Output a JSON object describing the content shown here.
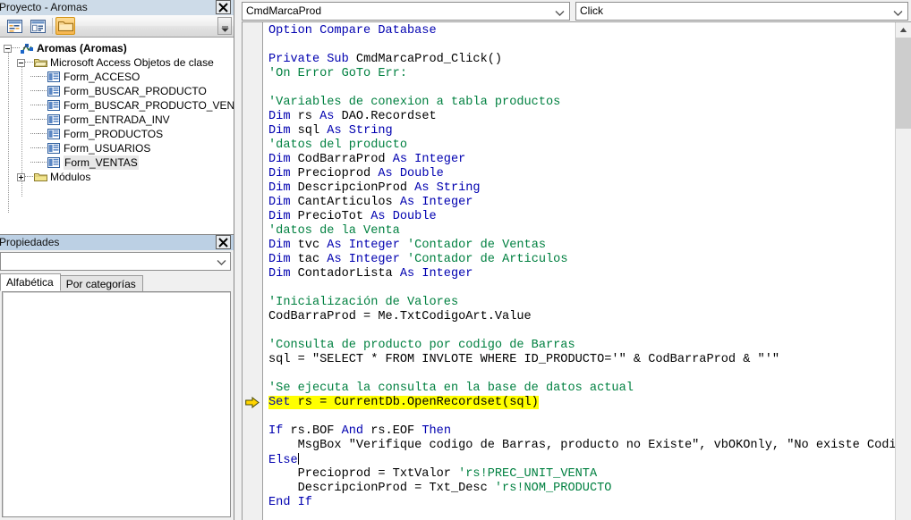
{
  "project_pane": {
    "title": "Proyecto - Aromas",
    "close_icon": "close-icon",
    "toolbar": {
      "view_code_label": "Ver código",
      "view_object_label": "Ver objeto",
      "toggle_folders_label": "Alternar carpetas",
      "overflow_label": "Más botones"
    },
    "tree": [
      {
        "label": "Aromas (Aromas)",
        "icon": "project-icon",
        "depth": 0,
        "expander": "minus",
        "bold": true
      },
      {
        "label": "Microsoft Access Objetos de clase",
        "icon": "folder-open-icon",
        "depth": 1,
        "expander": "minus",
        "bold": false
      },
      {
        "label": "Form_ACCESO",
        "icon": "form-module-icon",
        "depth": 2,
        "expander": "none",
        "bold": false
      },
      {
        "label": "Form_BUSCAR_PRODUCTO",
        "icon": "form-module-icon",
        "depth": 2,
        "expander": "none",
        "bold": false
      },
      {
        "label": "Form_BUSCAR_PRODUCTO_VENTA",
        "icon": "form-module-icon",
        "depth": 2,
        "expander": "none",
        "bold": false
      },
      {
        "label": "Form_ENTRADA_INV",
        "icon": "form-module-icon",
        "depth": 2,
        "expander": "none",
        "bold": false
      },
      {
        "label": "Form_PRODUCTOS",
        "icon": "form-module-icon",
        "depth": 2,
        "expander": "none",
        "bold": false
      },
      {
        "label": "Form_USUARIOS",
        "icon": "form-module-icon",
        "depth": 2,
        "expander": "none",
        "bold": false
      },
      {
        "label": "Form_VENTAS",
        "icon": "form-module-icon",
        "depth": 2,
        "expander": "none",
        "bold": false,
        "selected": true
      },
      {
        "label": "Módulos",
        "icon": "folder-closed-icon",
        "depth": 1,
        "expander": "plus",
        "bold": false
      }
    ]
  },
  "properties_pane": {
    "title": "Propiedades",
    "close_icon": "close-icon",
    "selector_value": "",
    "tabs": [
      {
        "label": "Alfabética",
        "active": true
      },
      {
        "label": "Por categorías",
        "active": false
      }
    ],
    "list_rows": []
  },
  "code_window": {
    "object_combo": {
      "value": "CmdMarcaProd",
      "caret_icon": "chevron-down-icon"
    },
    "procedure_combo": {
      "value": "Click",
      "caret_icon": "chevron-down-icon"
    },
    "margin_marker_icon": "yellow-arrow-icon",
    "margin_marker_line": 28,
    "scrollbar": {
      "up_icon": "chevron-up-icon",
      "thumb_position": "top"
    },
    "lines": [
      {
        "n": 1,
        "segs": [
          {
            "t": "Option Compare Database",
            "c": "kw"
          }
        ]
      },
      {
        "n": 2,
        "segs": []
      },
      {
        "n": 3,
        "segs": [
          {
            "t": "Private Sub ",
            "c": "kw"
          },
          {
            "t": "CmdMarcaProd_Click()",
            "c": "tx"
          }
        ]
      },
      {
        "n": 4,
        "segs": [
          {
            "t": "'On Error GoTo Err:",
            "c": "cm"
          }
        ]
      },
      {
        "n": 5,
        "segs": []
      },
      {
        "n": 6,
        "segs": [
          {
            "t": "'Variables de conexion a tabla productos",
            "c": "cm"
          }
        ]
      },
      {
        "n": 7,
        "segs": [
          {
            "t": "Dim ",
            "c": "kw"
          },
          {
            "t": "rs ",
            "c": "tx"
          },
          {
            "t": "As ",
            "c": "kw"
          },
          {
            "t": "DAO.Recordset",
            "c": "tx"
          }
        ]
      },
      {
        "n": 8,
        "segs": [
          {
            "t": "Dim ",
            "c": "kw"
          },
          {
            "t": "sql ",
            "c": "tx"
          },
          {
            "t": "As String",
            "c": "kw"
          }
        ]
      },
      {
        "n": 9,
        "segs": [
          {
            "t": "'datos del producto",
            "c": "cm"
          }
        ]
      },
      {
        "n": 10,
        "segs": [
          {
            "t": "Dim ",
            "c": "kw"
          },
          {
            "t": "CodBarraProd ",
            "c": "tx"
          },
          {
            "t": "As Integer",
            "c": "kw"
          }
        ]
      },
      {
        "n": 11,
        "segs": [
          {
            "t": "Dim ",
            "c": "kw"
          },
          {
            "t": "Precioprod ",
            "c": "tx"
          },
          {
            "t": "As Double",
            "c": "kw"
          }
        ]
      },
      {
        "n": 12,
        "segs": [
          {
            "t": "Dim ",
            "c": "kw"
          },
          {
            "t": "DescripcionProd ",
            "c": "tx"
          },
          {
            "t": "As String",
            "c": "kw"
          }
        ]
      },
      {
        "n": 13,
        "segs": [
          {
            "t": "Dim ",
            "c": "kw"
          },
          {
            "t": "CantArticulos ",
            "c": "tx"
          },
          {
            "t": "As Integer",
            "c": "kw"
          }
        ]
      },
      {
        "n": 14,
        "segs": [
          {
            "t": "Dim ",
            "c": "kw"
          },
          {
            "t": "PrecioTot ",
            "c": "tx"
          },
          {
            "t": "As Double",
            "c": "kw"
          }
        ]
      },
      {
        "n": 15,
        "segs": [
          {
            "t": "'datos de la Venta",
            "c": "cm"
          }
        ]
      },
      {
        "n": 16,
        "segs": [
          {
            "t": "Dim ",
            "c": "kw"
          },
          {
            "t": "tvc ",
            "c": "tx"
          },
          {
            "t": "As Integer ",
            "c": "kw"
          },
          {
            "t": "'Contador de Ventas",
            "c": "cm"
          }
        ]
      },
      {
        "n": 17,
        "segs": [
          {
            "t": "Dim ",
            "c": "kw"
          },
          {
            "t": "tac ",
            "c": "tx"
          },
          {
            "t": "As Integer ",
            "c": "kw"
          },
          {
            "t": "'Contador de Articulos",
            "c": "cm"
          }
        ]
      },
      {
        "n": 18,
        "segs": [
          {
            "t": "Dim ",
            "c": "kw"
          },
          {
            "t": "ContadorLista ",
            "c": "tx"
          },
          {
            "t": "As Integer",
            "c": "kw"
          }
        ]
      },
      {
        "n": 19,
        "segs": []
      },
      {
        "n": 20,
        "segs": [
          {
            "t": "'Inicialización de Valores",
            "c": "cm"
          }
        ]
      },
      {
        "n": 21,
        "segs": [
          {
            "t": "CodBarraProd = Me.TxtCodigoArt.Value",
            "c": "tx"
          }
        ]
      },
      {
        "n": 22,
        "segs": []
      },
      {
        "n": 23,
        "segs": [
          {
            "t": "'Consulta de producto por codigo de Barras",
            "c": "cm"
          }
        ]
      },
      {
        "n": 24,
        "segs": [
          {
            "t": "sql = \"SELECT * FROM INVLOTE WHERE ID_PRODUCTO='\" & CodBarraProd & \"'\"",
            "c": "tx"
          }
        ]
      },
      {
        "n": 25,
        "segs": []
      },
      {
        "n": 26,
        "segs": [
          {
            "t": "'Se ejecuta la consulta en la base de datos actual",
            "c": "cm"
          }
        ]
      },
      {
        "n": 27,
        "segs": [
          {
            "t": "Set ",
            "c": "kw",
            "hl": true
          },
          {
            "t": "rs = CurrentDb.OpenRecordset(sql)",
            "c": "tx",
            "hl": true
          }
        ]
      },
      {
        "n": 28,
        "segs": []
      },
      {
        "n": 29,
        "segs": [
          {
            "t": "If ",
            "c": "kw"
          },
          {
            "t": "rs.BOF ",
            "c": "tx"
          },
          {
            "t": "And ",
            "c": "kw"
          },
          {
            "t": "rs.EOF ",
            "c": "tx"
          },
          {
            "t": "Then",
            "c": "kw"
          }
        ]
      },
      {
        "n": 30,
        "segs": [
          {
            "t": "    MsgBox \"Verifique codigo de Barras, producto no Existe\", vbOKOnly, \"No existe Codigo",
            "c": "tx"
          }
        ]
      },
      {
        "n": 31,
        "segs": [
          {
            "t": "Else",
            "c": "kw"
          }
        ],
        "caret_after": true
      },
      {
        "n": 32,
        "segs": [
          {
            "t": "    Precioprod = TxtValor ",
            "c": "tx"
          },
          {
            "t": "'rs!PREC_UNIT_VENTA",
            "c": "cm"
          }
        ]
      },
      {
        "n": 33,
        "segs": [
          {
            "t": "    DescripcionProd = Txt_Desc ",
            "c": "tx"
          },
          {
            "t": "'rs!NOM_PRODUCTO",
            "c": "cm"
          }
        ]
      },
      {
        "n": 34,
        "segs": [
          {
            "t": "End If",
            "c": "kw"
          }
        ]
      }
    ]
  }
}
